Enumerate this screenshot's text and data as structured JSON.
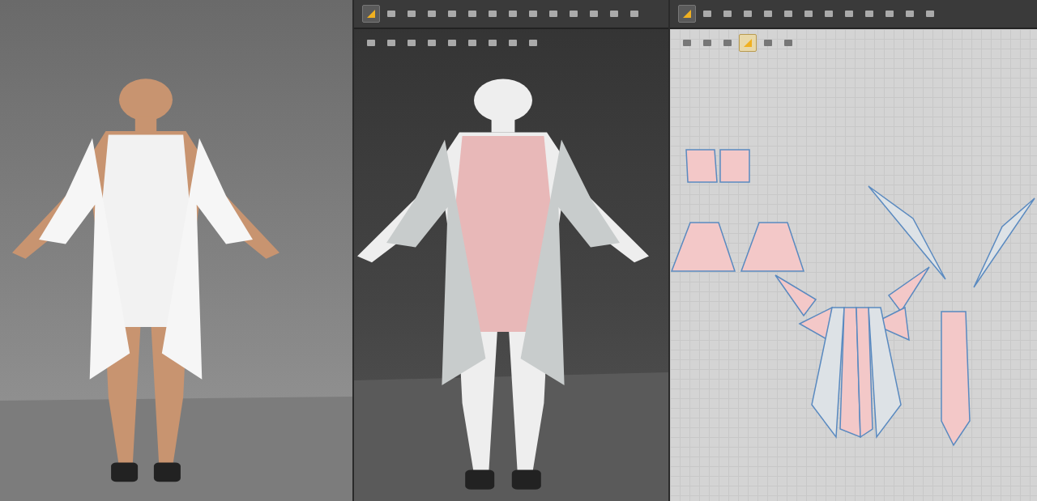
{
  "viewer_3d": {
    "toolbar": [
      {
        "selected": true
      },
      {
        "selected": false
      },
      {
        "selected": false
      },
      {
        "selected": false
      },
      {
        "selected": false
      },
      {
        "selected": false
      },
      {
        "selected": false
      },
      {
        "selected": false
      },
      {
        "selected": false
      },
      {
        "selected": false
      },
      {
        "selected": false
      },
      {
        "selected": false
      },
      {
        "selected": false
      },
      {
        "selected": false
      }
    ],
    "display_toolbar": [
      {
        "selected": false
      },
      {
        "selected": false
      },
      {
        "selected": false
      },
      {
        "selected": false
      },
      {
        "selected": false
      },
      {
        "selected": false
      },
      {
        "selected": false
      },
      {
        "selected": false
      },
      {
        "selected": false
      }
    ]
  },
  "pattern_2d": {
    "toolbar": [
      {
        "selected": true
      },
      {
        "selected": false
      },
      {
        "selected": false
      },
      {
        "selected": false
      },
      {
        "selected": false
      },
      {
        "selected": false
      },
      {
        "selected": false
      },
      {
        "selected": false
      },
      {
        "selected": false
      },
      {
        "selected": false
      },
      {
        "selected": false
      },
      {
        "selected": false
      },
      {
        "selected": false
      }
    ],
    "sub_toolbar": [
      {
        "selected": false
      },
      {
        "selected": false
      },
      {
        "selected": false
      },
      {
        "selected": true
      },
      {
        "selected": false
      },
      {
        "selected": false
      }
    ]
  }
}
